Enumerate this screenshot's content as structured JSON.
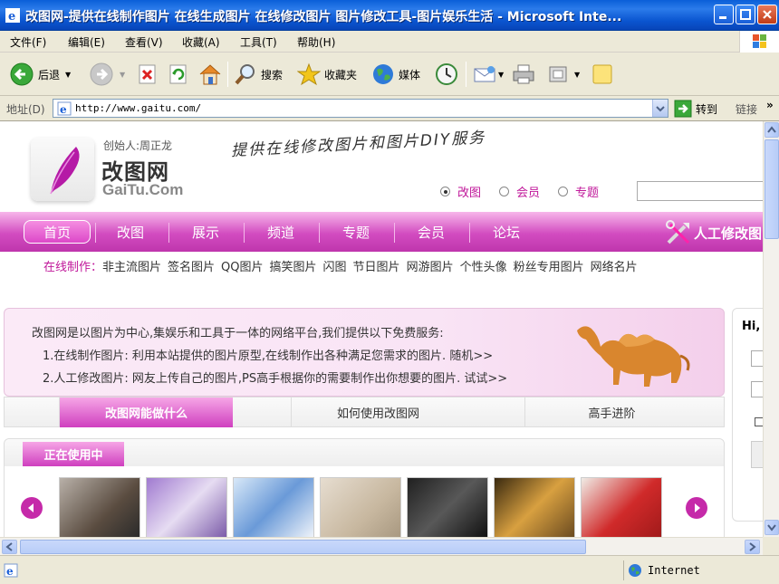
{
  "window": {
    "title": "改图网-提供在线制作图片 在线生成图片 在线修改图片 图片修改工具-图片娱乐生活 - Microsoft Inte..."
  },
  "menu": [
    "文件(F)",
    "编辑(E)",
    "查看(V)",
    "收藏(A)",
    "工具(T)",
    "帮助(H)"
  ],
  "toolbar": {
    "back_label": "后退",
    "search_label": "搜索",
    "favorites_label": "收藏夹",
    "media_label": "媒体"
  },
  "address": {
    "label": "地址(D)",
    "url": "http://www.gaitu.com/",
    "go_label": "转到",
    "links_label": "链接"
  },
  "site": {
    "creator": "创始人:周正龙",
    "brand": "改图网",
    "brand_en": "GaiTu.Com",
    "slogan": "提供在线修改图片和图片DIY服务",
    "search_options": [
      "改图",
      "会员",
      "专题"
    ],
    "nav": [
      "首页",
      "改图",
      "展示",
      "频道",
      "专题",
      "会员",
      "论坛"
    ],
    "nav_right": "人工修改图",
    "subnav_lead": "在线制作：",
    "subnav": [
      "非主流图片",
      "签名图片",
      "QQ图片",
      "搞笑图片",
      "闪图",
      "节日图片",
      "网游图片",
      "个性头像",
      "粉丝专用图片",
      "网络名片"
    ],
    "intro": "改图网是以图片为中心,集娱乐和工具于一体的网络平台,我们提供以下免费服务:",
    "service1": "1.在线制作图片: 利用本站提供的图片原型,在线制作出各种满足您需求的图片. 随机>>",
    "service2": "2.人工修改图片: 网友上传自己的图片,PS高手根据你的需要制作出你想要的图片. 试试>>",
    "tabs": [
      "改图网能做什么",
      "如何使用改图网",
      "高手进阶"
    ],
    "using_label": "正在使用中",
    "side_greeting": "Hi,"
  },
  "status": {
    "zone": "Internet"
  },
  "colors": {
    "accent": "#c0179a",
    "nav_pink": "#d24cc0",
    "xp_blue": "#0a5fd8"
  }
}
